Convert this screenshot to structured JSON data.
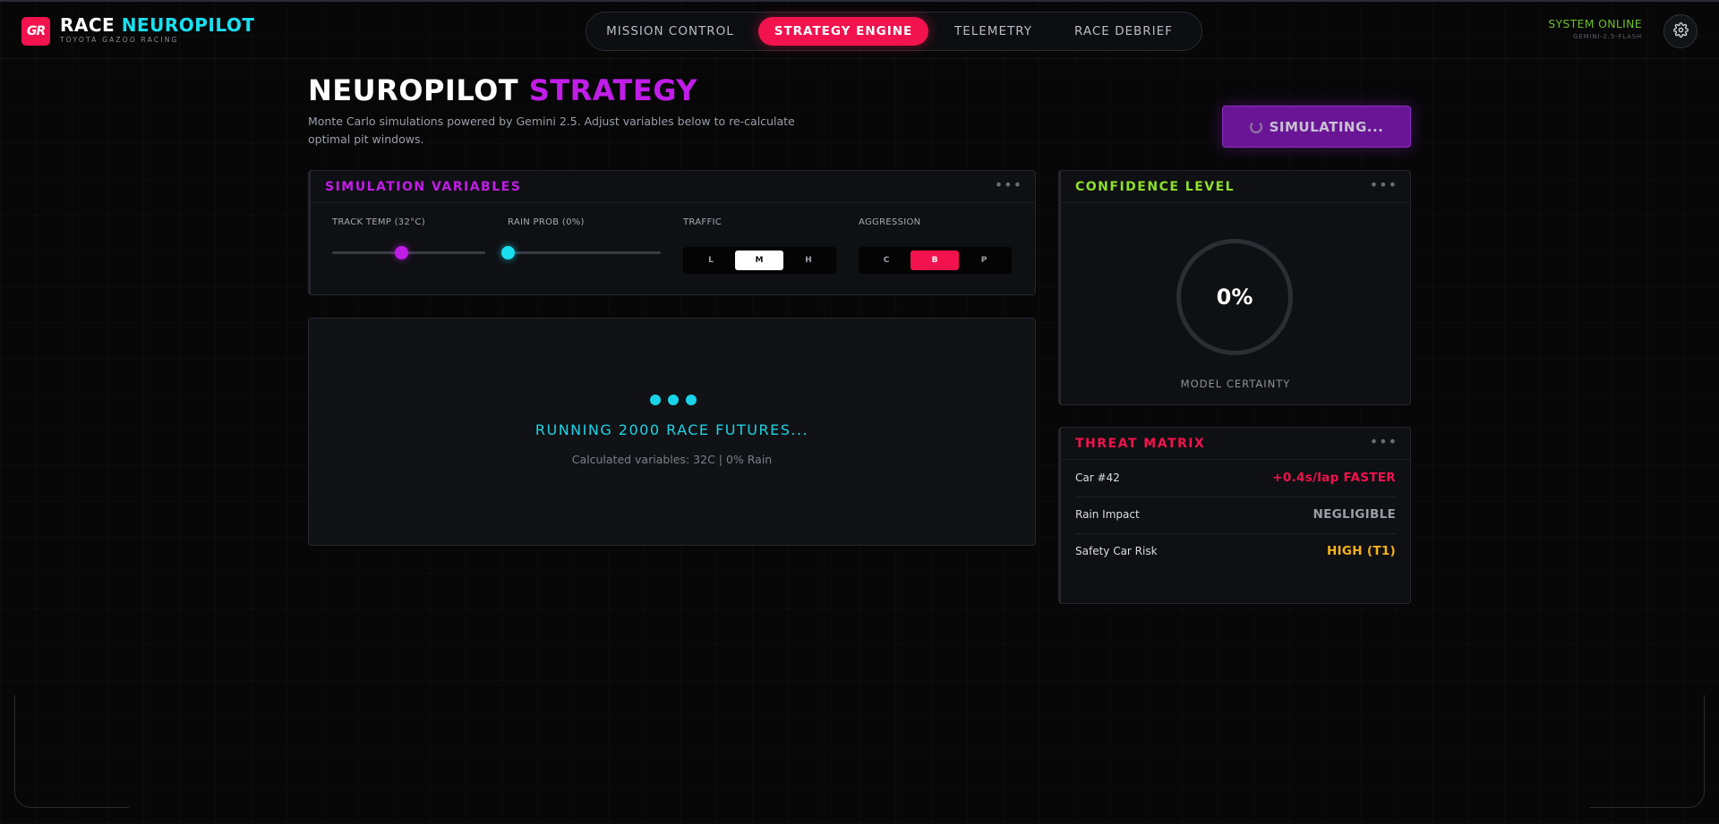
{
  "brand": {
    "badge": "GR",
    "title_part1": "RACE",
    "title_part2": "NEUROPILOT",
    "subtitle": "TOYOTA GAZOO RACING"
  },
  "nav": {
    "items": [
      {
        "label": "MISSION CONTROL",
        "active": false
      },
      {
        "label": "STRATEGY ENGINE",
        "active": true
      },
      {
        "label": "TELEMETRY",
        "active": false
      },
      {
        "label": "RACE DEBRIEF",
        "active": false
      }
    ]
  },
  "system": {
    "status": "SYSTEM ONLINE",
    "model": "GEMINI-2.5-FLASH"
  },
  "page": {
    "title_part1": "NEUROPILOT",
    "title_part2": "STRATEGY",
    "description": "Monte Carlo simulations powered by Gemini 2.5. Adjust variables below to re-calculate optimal pit windows.",
    "simulate_button": "SIMULATING..."
  },
  "variables": {
    "title": "SIMULATION VARIABLES",
    "track_temp": {
      "label": "TRACK TEMP (32°C)",
      "level": 0.45
    },
    "rain_prob": {
      "label": "RAIN PROB (0%)",
      "level": 0.0
    },
    "traffic": {
      "label": "TRAFFIC",
      "options": [
        "L",
        "M",
        "H"
      ],
      "selected": "M"
    },
    "aggression": {
      "label": "AGGRESSION",
      "options": [
        "C",
        "B",
        "P"
      ],
      "selected": "B"
    }
  },
  "simulation": {
    "running_text": "RUNNING 2000 RACE FUTURES...",
    "calculated_text": "Calculated variables: 32C | 0% Rain"
  },
  "confidence": {
    "title": "CONFIDENCE LEVEL",
    "value": "0%",
    "caption": "MODEL CERTAINTY"
  },
  "threats": {
    "title": "THREAT MATRIX",
    "rows": [
      {
        "label": "Car #42",
        "value": "+0.4s/lap FASTER",
        "color": "#f2124e"
      },
      {
        "label": "Rain Impact",
        "value": "NEGLIGIBLE",
        "color": "#9a9ea6"
      },
      {
        "label": "Safety Car Risk",
        "value": "HIGH (T1)",
        "color": "#f5b21b"
      }
    ]
  },
  "colors": {
    "accent_red": "#f2124e",
    "accent_cyan": "#19e0f0",
    "accent_purple": "#c11de8",
    "accent_green": "#8ee02a"
  },
  "icons": {
    "settings": "gear-icon",
    "panel_menu": "more-dots-icon",
    "loading": "spinner-icon"
  }
}
